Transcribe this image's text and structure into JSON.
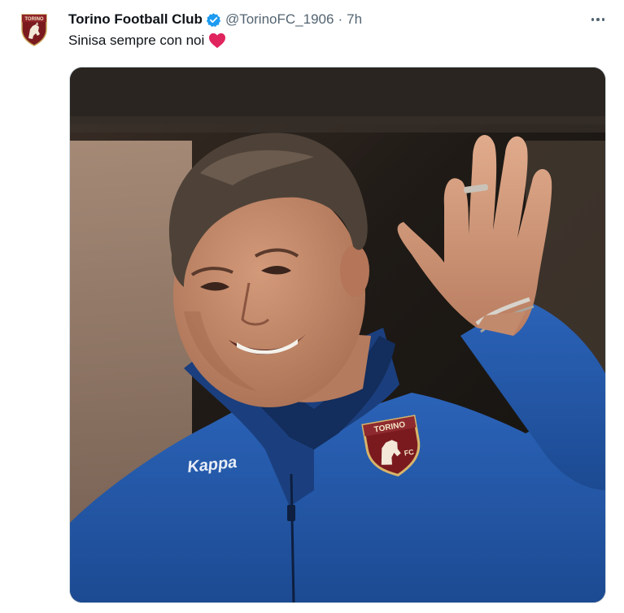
{
  "tweet": {
    "display_name": "Torino Football Club",
    "handle": "@TorinoFC_1906",
    "separator": "·",
    "time": "7h",
    "text": "Sinisa sempre con noi",
    "emoji": "red-heart-emoji",
    "avatar_text": "TORINO",
    "verified_icon": "verified-badge-icon",
    "more_icon": "more-options-icon"
  },
  "media": {
    "jacket_logo_text": "Kappa",
    "crest_text_top": "TORINO",
    "crest_text_bottom": "FC"
  },
  "colors": {
    "verified": "#1d9bf0",
    "heart": "#e0245e",
    "maroon": "#7a1a1f",
    "jacket_blue": "#2559a8"
  }
}
